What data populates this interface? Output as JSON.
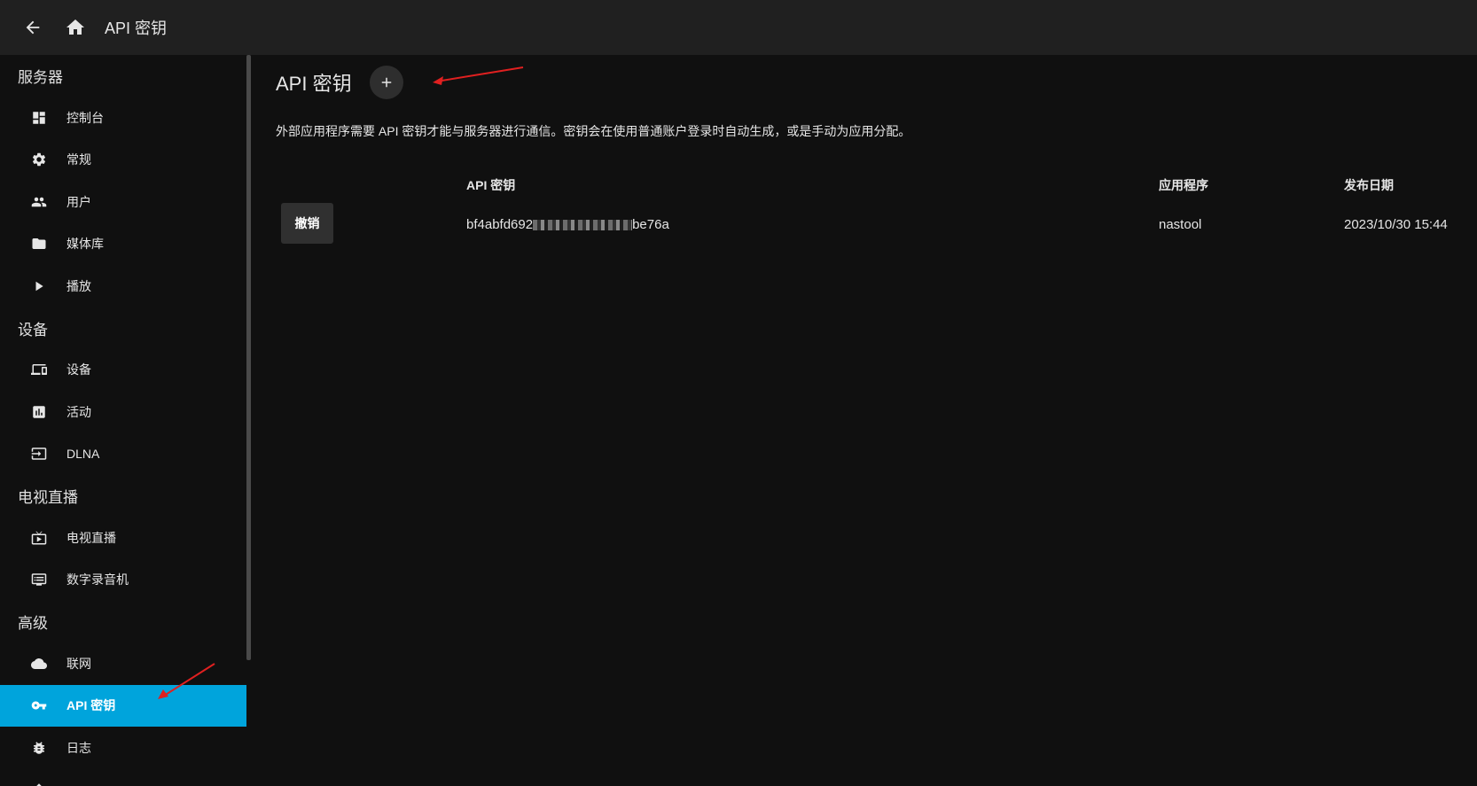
{
  "topbar": {
    "title": "API 密钥",
    "back_icon": "arrow-left-icon",
    "home_icon": "home-icon"
  },
  "sidebar": {
    "sections": [
      {
        "header": "服务器",
        "items": [
          {
            "label": "控制台",
            "icon": "dashboard-icon"
          },
          {
            "label": "常规",
            "icon": "gear-icon"
          },
          {
            "label": "用户",
            "icon": "people-icon"
          },
          {
            "label": "媒体库",
            "icon": "folder-icon"
          },
          {
            "label": "播放",
            "icon": "play-icon"
          }
        ]
      },
      {
        "header": "设备",
        "items": [
          {
            "label": "设备",
            "icon": "devices-icon"
          },
          {
            "label": "活动",
            "icon": "assessment-icon"
          },
          {
            "label": "DLNA",
            "icon": "input-icon"
          }
        ]
      },
      {
        "header": "电视直播",
        "items": [
          {
            "label": "电视直播",
            "icon": "live-tv-icon"
          },
          {
            "label": "数字录音机",
            "icon": "dvr-icon"
          }
        ]
      },
      {
        "header": "高级",
        "items": [
          {
            "label": "联网",
            "icon": "cloud-icon"
          },
          {
            "label": "API 密钥",
            "icon": "key-icon",
            "active": true
          },
          {
            "label": "日志",
            "icon": "bug-icon"
          }
        ]
      }
    ]
  },
  "main": {
    "title": "API 密钥",
    "add_icon": "plus-icon",
    "description": "外部应用程序需要 API 密钥才能与服务器进行通信。密钥会在使用普通账户登录时自动生成，或是手动为应用分配。",
    "table": {
      "headers": [
        "API 密钥",
        "应用程序",
        "发布日期"
      ],
      "rows": [
        {
          "action_label": "撤销",
          "key_prefix": "bf4abfd692",
          "key_suffix": "be76a",
          "app": "nastool",
          "date": "2023/10/30 15:44"
        }
      ]
    }
  },
  "colors": {
    "accent": "#00a4dc",
    "topbar_bg": "#202020",
    "page_bg": "#101010",
    "annotation_arrow": "#e02020"
  }
}
